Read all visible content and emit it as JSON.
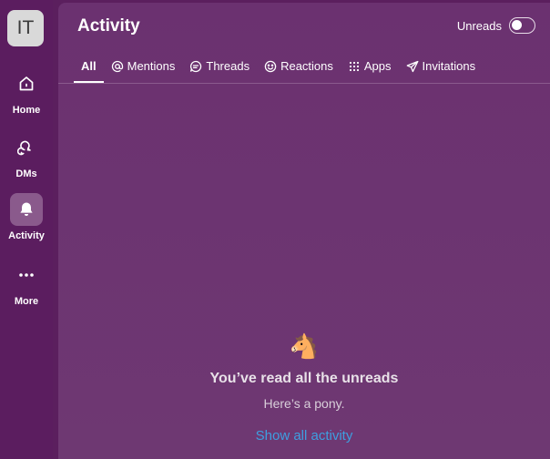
{
  "workspace": {
    "initials": "IT"
  },
  "rail": {
    "items": [
      {
        "label": "Home",
        "icon": "home-icon"
      },
      {
        "label": "DMs",
        "icon": "dms-icon"
      },
      {
        "label": "Activity",
        "icon": "bell-icon",
        "active": true
      },
      {
        "label": "More",
        "icon": "more-icon"
      }
    ]
  },
  "header": {
    "title": "Activity",
    "unreads_label": "Unreads",
    "unreads_on": false
  },
  "tabs": [
    {
      "label": "All",
      "active": true
    },
    {
      "label": "Mentions",
      "icon": "at-icon"
    },
    {
      "label": "Threads",
      "icon": "threads-icon"
    },
    {
      "label": "Reactions",
      "icon": "smile-icon"
    },
    {
      "label": "Apps",
      "icon": "apps-icon"
    },
    {
      "label": "Invitations",
      "icon": "send-icon"
    }
  ],
  "empty_state": {
    "emoji": "🐴",
    "title": "You’ve read all the unreads",
    "subtitle": "Here’s a pony.",
    "link": "Show all activity"
  },
  "colors": {
    "rail_bg": "#5b1d5f",
    "panel_bg": "#6c346f",
    "link": "#3e9fe0"
  }
}
